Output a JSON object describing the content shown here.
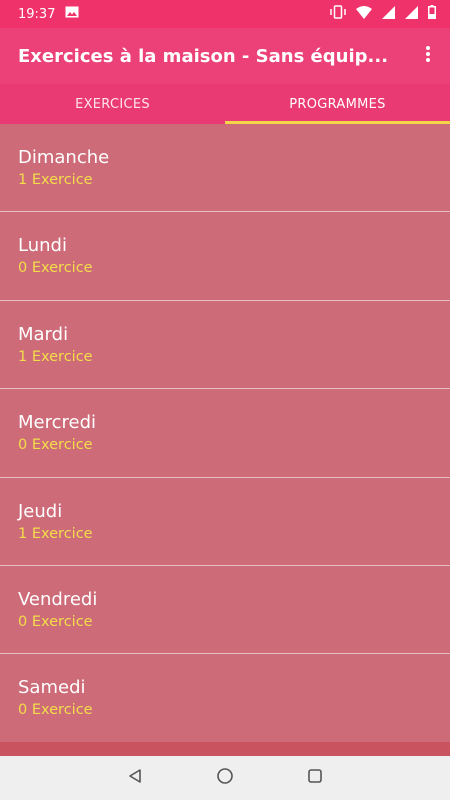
{
  "status_bar": {
    "time": "19:37"
  },
  "app_bar": {
    "title": "Exercices à la maison - Sans équip..."
  },
  "tabs": [
    {
      "label": "EXERCICES",
      "active": false
    },
    {
      "label": "PROGRAMMES",
      "active": true
    }
  ],
  "days": [
    {
      "name": "Dimanche",
      "count": "1 Exercice"
    },
    {
      "name": "Lundi",
      "count": "0 Exercice"
    },
    {
      "name": "Mardi",
      "count": "1 Exercice"
    },
    {
      "name": "Mercredi",
      "count": "0 Exercice"
    },
    {
      "name": "Jeudi",
      "count": "1 Exercice"
    },
    {
      "name": "Vendredi",
      "count": "0 Exercice"
    },
    {
      "name": "Samedi",
      "count": "0 Exercice"
    }
  ],
  "colors": {
    "status_bar": "#f0326a",
    "app_bar": "#ec4079",
    "list_background": "#cd6b78",
    "subtitle": "#f3de4a",
    "tab_indicator": "#f6d54b"
  },
  "icons": {
    "status_left": [
      "image-icon"
    ],
    "status_right": [
      "vibrate-icon",
      "wifi-icon",
      "signal-icon",
      "signal-icon",
      "battery-icon"
    ],
    "app_bar": [
      "more-vert-icon"
    ],
    "nav": [
      "back-icon",
      "home-icon",
      "recents-icon"
    ]
  }
}
